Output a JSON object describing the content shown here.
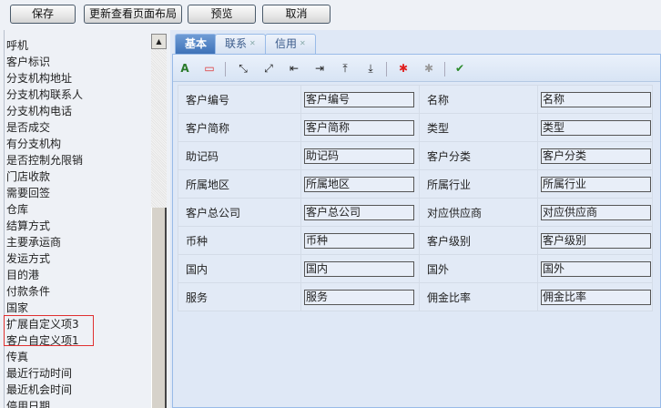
{
  "toolbar": {
    "save": "保存",
    "update_layout": "更新查看页面布局",
    "preview": "预览",
    "cancel": "取消"
  },
  "field_list": [
    "呼机",
    "客户标识",
    "分支机构地址",
    "分支机构联系人",
    "分支机构电话",
    "是否成交",
    "有分支机构",
    "是否控制允限销",
    "门店收款",
    "需要回签",
    "仓库",
    "结算方式",
    "主要承运商",
    "发运方式",
    "目的港",
    "付款条件",
    "国家",
    "扩展自定义项3",
    "客户自定义项1",
    "传真",
    "最近行动时间",
    "最近机会时间",
    "停用日期"
  ],
  "tabs": [
    {
      "label": "基本"
    },
    {
      "label": "联系",
      "close": "✕"
    },
    {
      "label": "信用",
      "close": "✕"
    }
  ],
  "form_rows": [
    {
      "l1": "客户编号",
      "v1": "客户编号",
      "l2": "名称",
      "v2": "名称"
    },
    {
      "l1": "客户简称",
      "v1": "客户简称",
      "l2": "类型",
      "v2": "类型"
    },
    {
      "l1": "助记码",
      "v1": "助记码",
      "l2": "客户分类",
      "v2": "客户分类"
    },
    {
      "l1": "所属地区",
      "v1": "所属地区",
      "l2": "所属行业",
      "v2": "所属行业"
    },
    {
      "l1": "客户总公司",
      "v1": "客户总公司",
      "l2": "对应供应商",
      "v2": "对应供应商"
    },
    {
      "l1": "币种",
      "v1": "币种",
      "l2": "客户级别",
      "v2": "客户级别"
    },
    {
      "l1": "国内",
      "v1": "国内",
      "l2": "国外",
      "v2": "国外"
    },
    {
      "l1": "服务",
      "v1": "服务",
      "l2": "佣金比率",
      "v2": "佣金比率"
    }
  ]
}
